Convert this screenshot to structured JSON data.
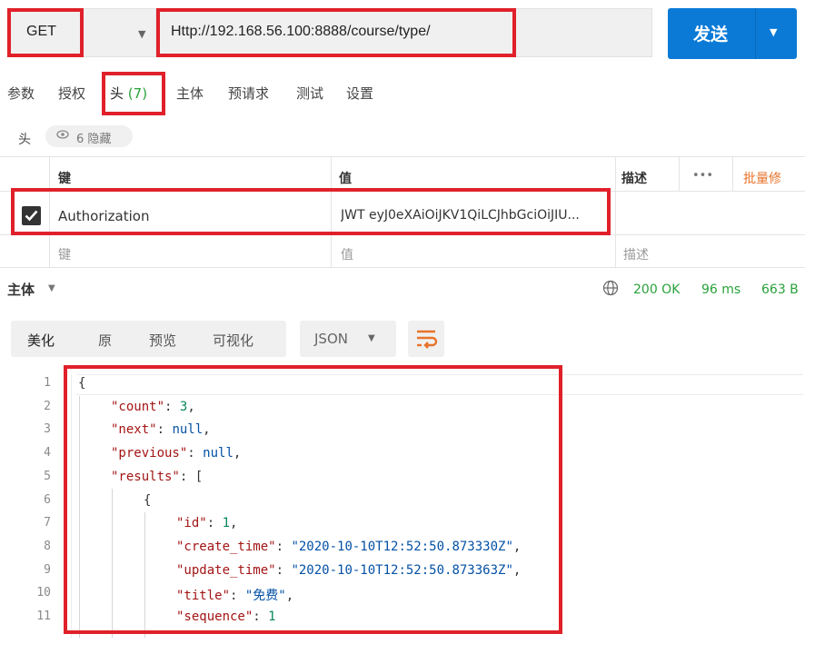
{
  "request": {
    "method": "GET",
    "url": "Http://192.168.56.100:8888/course/type/",
    "send_label": "发送"
  },
  "tabs": [
    {
      "label": "参数"
    },
    {
      "label": "授权"
    },
    {
      "label": "头",
      "count": "(7)"
    },
    {
      "label": "主体"
    },
    {
      "label": "预请求"
    },
    {
      "label": "测试"
    },
    {
      "label": "设置"
    }
  ],
  "headers_section": {
    "label": "头",
    "hidden_text": "6 隐藏"
  },
  "table": {
    "columns": {
      "key": "键",
      "value": "值",
      "desc": "描述",
      "more": "•••",
      "bulk_edit": "批量修"
    },
    "row": {
      "checked": true,
      "key": "Authorization",
      "value": "JWT eyJ0eXAiOiJKV1QiLCJhbGciOiJIU..."
    },
    "placeholders": {
      "key": "键",
      "value": "值",
      "desc": "描述"
    }
  },
  "response": {
    "body_label": "主体",
    "status": "200 OK",
    "time": "96 ms",
    "size": "663 B",
    "view_tabs": [
      "美化",
      "原",
      "预览",
      "可视化"
    ],
    "format": "JSON"
  },
  "code": {
    "line_numbers": [
      "1",
      "2",
      "3",
      "4",
      "5",
      "6",
      "7",
      "8",
      "9",
      "10",
      "11"
    ],
    "lines": [
      {
        "indent": 0,
        "parts": [
          {
            "t": "p",
            "v": "{"
          }
        ]
      },
      {
        "indent": 1,
        "parts": [
          {
            "t": "k",
            "v": "\"count\""
          },
          {
            "t": "p",
            "v": ": "
          },
          {
            "t": "n",
            "v": "3"
          },
          {
            "t": "p",
            "v": ","
          }
        ]
      },
      {
        "indent": 1,
        "parts": [
          {
            "t": "k",
            "v": "\"next\""
          },
          {
            "t": "p",
            "v": ": "
          },
          {
            "t": "kw",
            "v": "null"
          },
          {
            "t": "p",
            "v": ","
          }
        ]
      },
      {
        "indent": 1,
        "parts": [
          {
            "t": "k",
            "v": "\"previous\""
          },
          {
            "t": "p",
            "v": ": "
          },
          {
            "t": "kw",
            "v": "null"
          },
          {
            "t": "p",
            "v": ","
          }
        ]
      },
      {
        "indent": 1,
        "parts": [
          {
            "t": "k",
            "v": "\"results\""
          },
          {
            "t": "p",
            "v": ": ["
          }
        ]
      },
      {
        "indent": 2,
        "parts": [
          {
            "t": "p",
            "v": "{"
          }
        ]
      },
      {
        "indent": 3,
        "parts": [
          {
            "t": "k",
            "v": "\"id\""
          },
          {
            "t": "p",
            "v": ": "
          },
          {
            "t": "n",
            "v": "1"
          },
          {
            "t": "p",
            "v": ","
          }
        ]
      },
      {
        "indent": 3,
        "parts": [
          {
            "t": "k",
            "v": "\"create_time\""
          },
          {
            "t": "p",
            "v": ": "
          },
          {
            "t": "s",
            "v": "\"2020-10-10T12:52:50.873330Z\""
          },
          {
            "t": "p",
            "v": ","
          }
        ]
      },
      {
        "indent": 3,
        "parts": [
          {
            "t": "k",
            "v": "\"update_time\""
          },
          {
            "t": "p",
            "v": ": "
          },
          {
            "t": "s",
            "v": "\"2020-10-10T12:52:50.873363Z\""
          },
          {
            "t": "p",
            "v": ","
          }
        ]
      },
      {
        "indent": 3,
        "parts": [
          {
            "t": "k",
            "v": "\"title\""
          },
          {
            "t": "p",
            "v": ": "
          },
          {
            "t": "s",
            "v": "\"免费\""
          },
          {
            "t": "p",
            "v": ","
          }
        ]
      },
      {
        "indent": 3,
        "parts": [
          {
            "t": "k",
            "v": "\"sequence\""
          },
          {
            "t": "p",
            "v": ": "
          },
          {
            "t": "n",
            "v": "1"
          }
        ]
      }
    ]
  },
  "colors": {
    "send_button": "#0a7ad6",
    "highlight": "#e0212a",
    "status_ok": "#2aa13a",
    "json_key": "#a31515",
    "json_string": "#0451a5",
    "json_number": "#098658"
  }
}
